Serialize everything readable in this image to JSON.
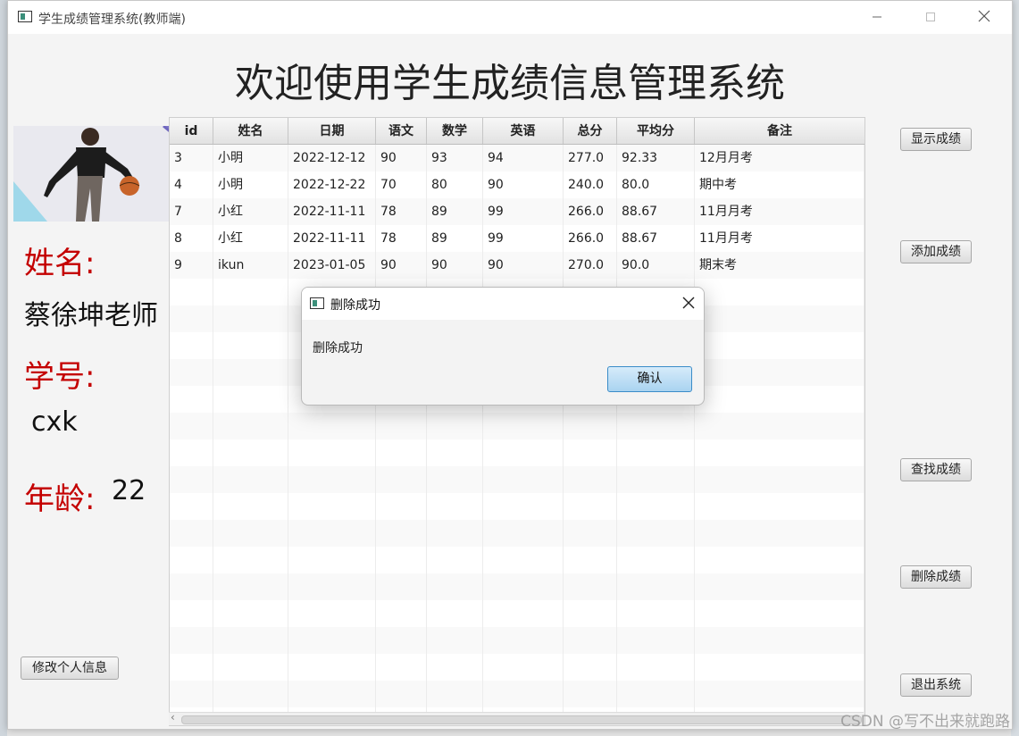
{
  "window": {
    "title": "学生成绩管理系统(教师端)",
    "minimize_icon": "minimize-icon",
    "maximize_icon": "maximize-icon",
    "close_icon": "close-icon"
  },
  "header": {
    "title": "欢迎使用学生成绩信息管理系统"
  },
  "profile": {
    "name_label": "姓名:",
    "name_value": "蔡徐坤老师",
    "id_label": "学号:",
    "id_value": "cxk",
    "age_label": "年龄:",
    "age_value": "22",
    "edit_button": "修改个人信息",
    "accent_color": "#c40000"
  },
  "table": {
    "columns": [
      "id",
      "姓名",
      "日期",
      "语文",
      "数学",
      "英语",
      "总分",
      "平均分",
      "备注"
    ],
    "rows": [
      [
        "3",
        "小明",
        "2022-12-12",
        "90",
        "93",
        "94",
        "277.0",
        "92.33",
        "12月月考"
      ],
      [
        "4",
        "小明",
        "2022-12-22",
        "70",
        "80",
        "90",
        "240.0",
        "80.0",
        "期中考"
      ],
      [
        "7",
        "小红",
        "2022-11-11",
        "78",
        "89",
        "99",
        "266.0",
        "88.67",
        "11月月考"
      ],
      [
        "8",
        "小红",
        "2022-11-11",
        "78",
        "89",
        "99",
        "266.0",
        "88.67",
        "11月月考"
      ],
      [
        "9",
        "ikun",
        "2023-01-05",
        "90",
        "90",
        "90",
        "270.0",
        "90.0",
        "期末考"
      ]
    ]
  },
  "actions": {
    "show": "显示成绩",
    "add": "添加成绩",
    "find": "查找成绩",
    "delete": "删除成绩",
    "exit": "退出系统"
  },
  "dialog": {
    "title": "删除成功",
    "message": "删除成功",
    "ok_button": "确认",
    "close_icon": "close-icon"
  },
  "watermark": "CSDN @写不出来就跑路"
}
